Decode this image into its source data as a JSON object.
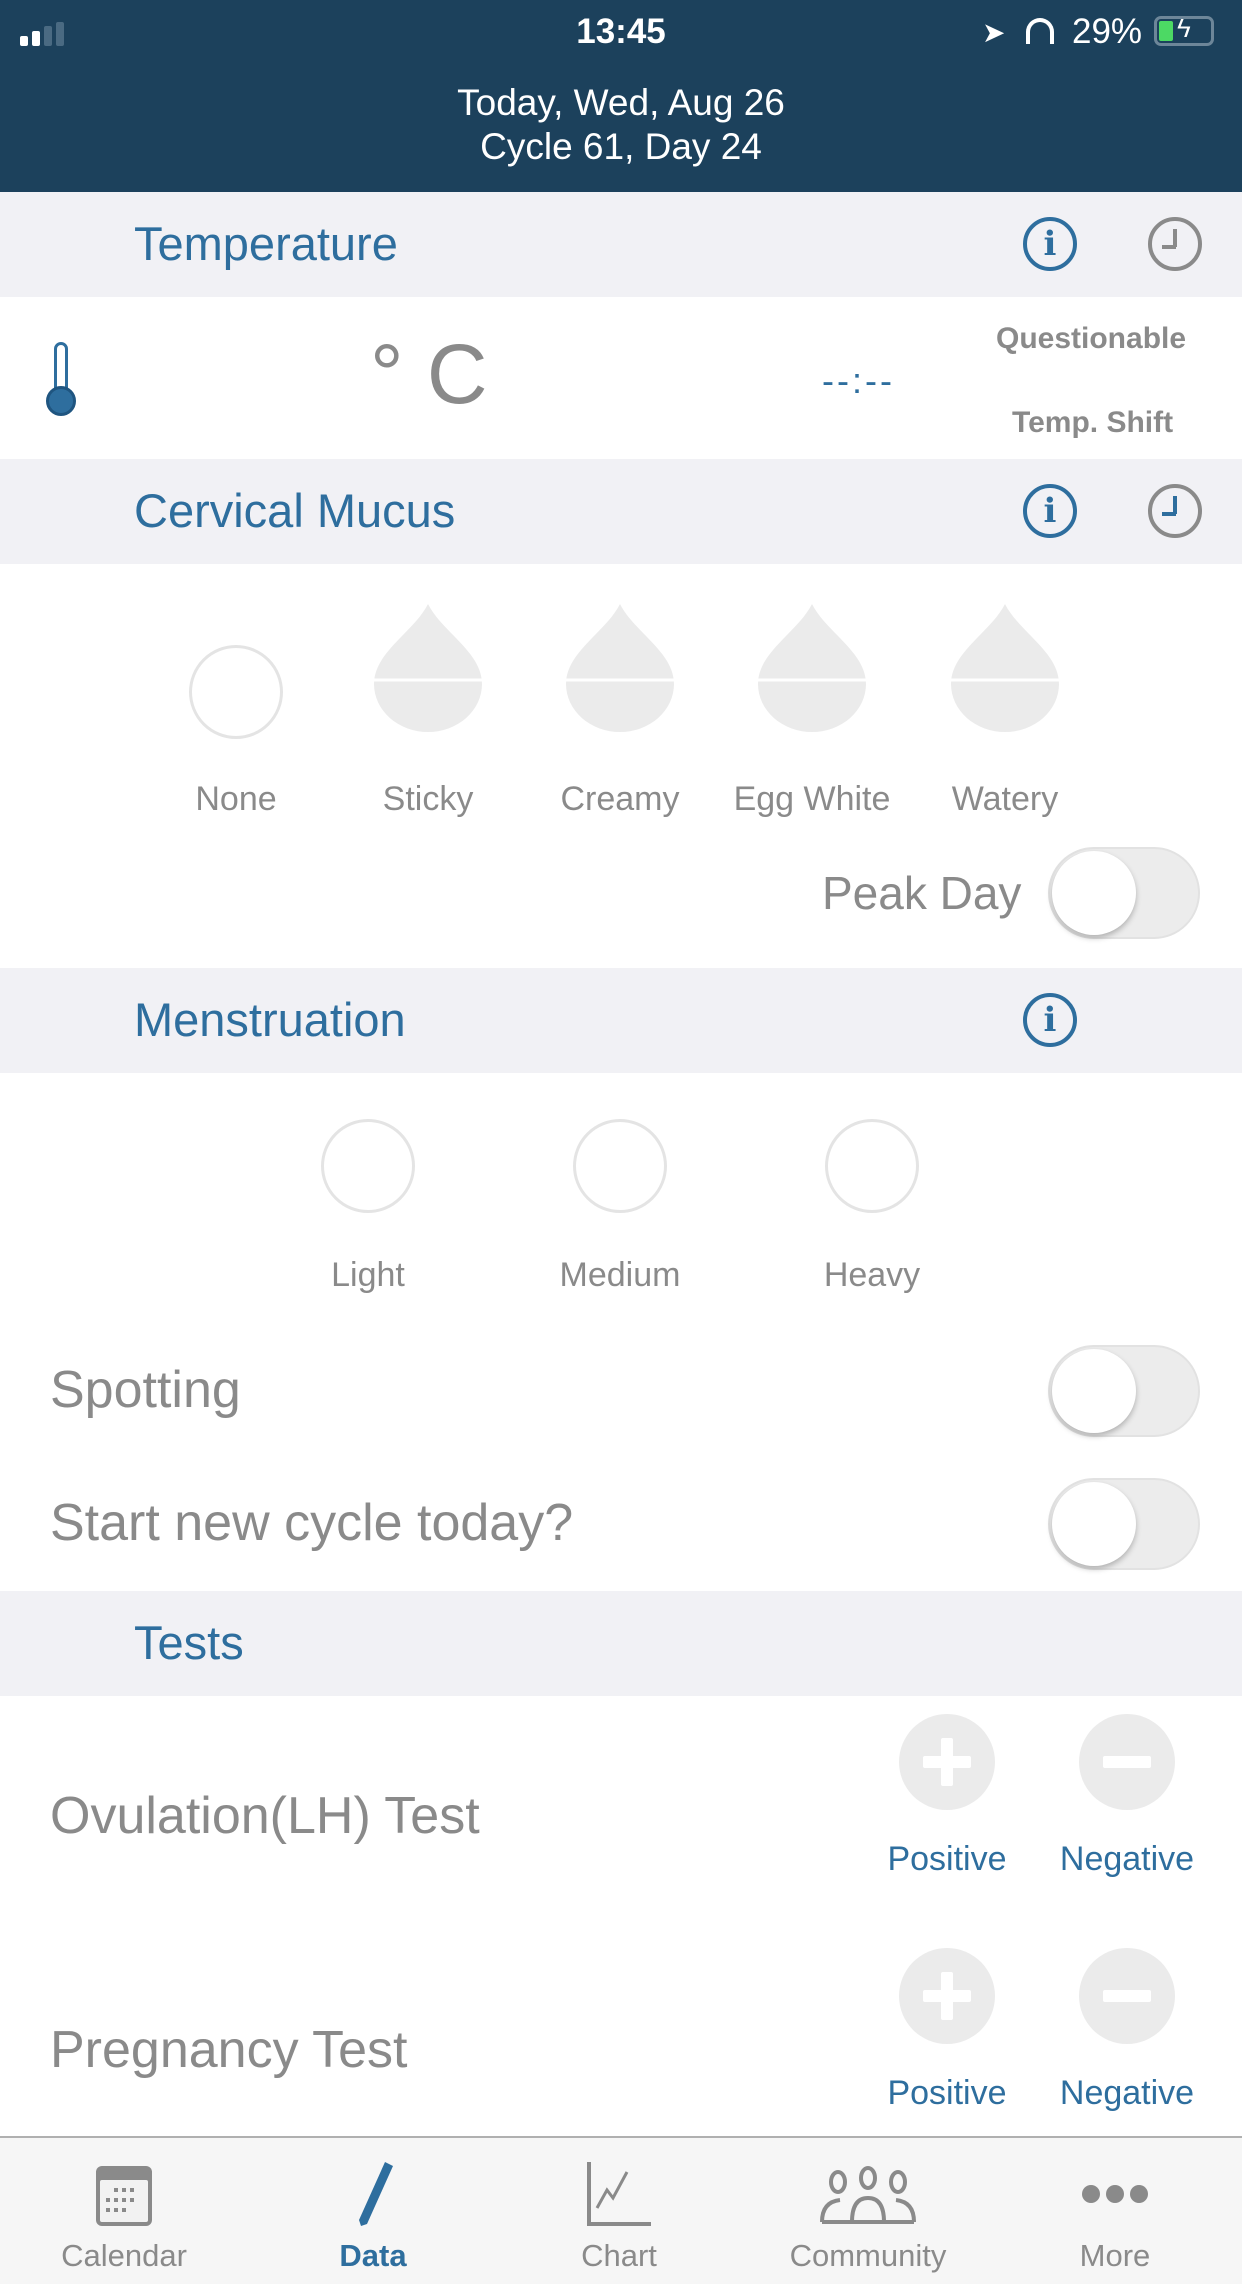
{
  "status_bar": {
    "time": "13:45",
    "battery": "29%"
  },
  "header": {
    "date": "Today, Wed, Aug 26",
    "cycle": "Cycle 61, Day 24"
  },
  "temperature": {
    "title": "Temperature",
    "unit": "° C",
    "time": "--:--",
    "questionable": "Questionable",
    "temp_shift": "Temp. Shift"
  },
  "cervical_mucus": {
    "title": "Cervical Mucus",
    "options": [
      "None",
      "Sticky",
      "Creamy",
      "Egg White",
      "Watery"
    ],
    "peak_day": "Peak Day",
    "peak_day_on": false
  },
  "menstruation": {
    "title": "Menstruation",
    "options": [
      "Light",
      "Medium",
      "Heavy"
    ],
    "spotting": "Spotting",
    "spotting_on": false,
    "new_cycle": "Start new cycle today?",
    "new_cycle_on": false
  },
  "tests": {
    "title": "Tests",
    "items": [
      {
        "label": "Ovulation(LH) Test",
        "positive": "Positive",
        "negative": "Negative"
      },
      {
        "label": "Pregnancy Test",
        "positive": "Positive",
        "negative": "Negative"
      }
    ]
  },
  "tabbar": {
    "items": [
      {
        "label": "Calendar"
      },
      {
        "label": "Data"
      },
      {
        "label": "Chart"
      },
      {
        "label": "Community"
      },
      {
        "label": "More"
      }
    ],
    "active": "Data"
  },
  "colors": {
    "header_bg": "#1c415c",
    "accent": "#2e6e9e",
    "section_bg": "#f1f1f5"
  }
}
